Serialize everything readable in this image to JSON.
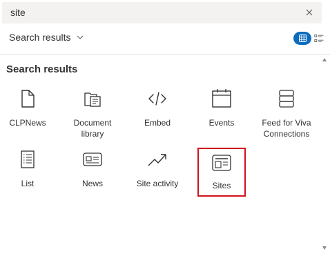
{
  "search": {
    "value": "site",
    "clear_icon": "close-icon"
  },
  "filter": {
    "label": "Search results"
  },
  "view": {
    "active": "grid",
    "accent": "#0f6cbd"
  },
  "results": {
    "title": "Search results",
    "items": [
      {
        "label": "CLPNews",
        "icon": "page-icon"
      },
      {
        "label": "Document library",
        "icon": "library-icon"
      },
      {
        "label": "Embed",
        "icon": "code-icon"
      },
      {
        "label": "Events",
        "icon": "calendar-icon"
      },
      {
        "label": "Feed for Viva Connections",
        "icon": "stack-icon"
      },
      {
        "label": "List",
        "icon": "list-icon"
      },
      {
        "label": "News",
        "icon": "news-icon"
      },
      {
        "label": "Site activity",
        "icon": "trend-icon"
      },
      {
        "label": "Sites",
        "icon": "sites-icon",
        "highlighted": true
      }
    ]
  },
  "highlight_color": "#d0101b"
}
